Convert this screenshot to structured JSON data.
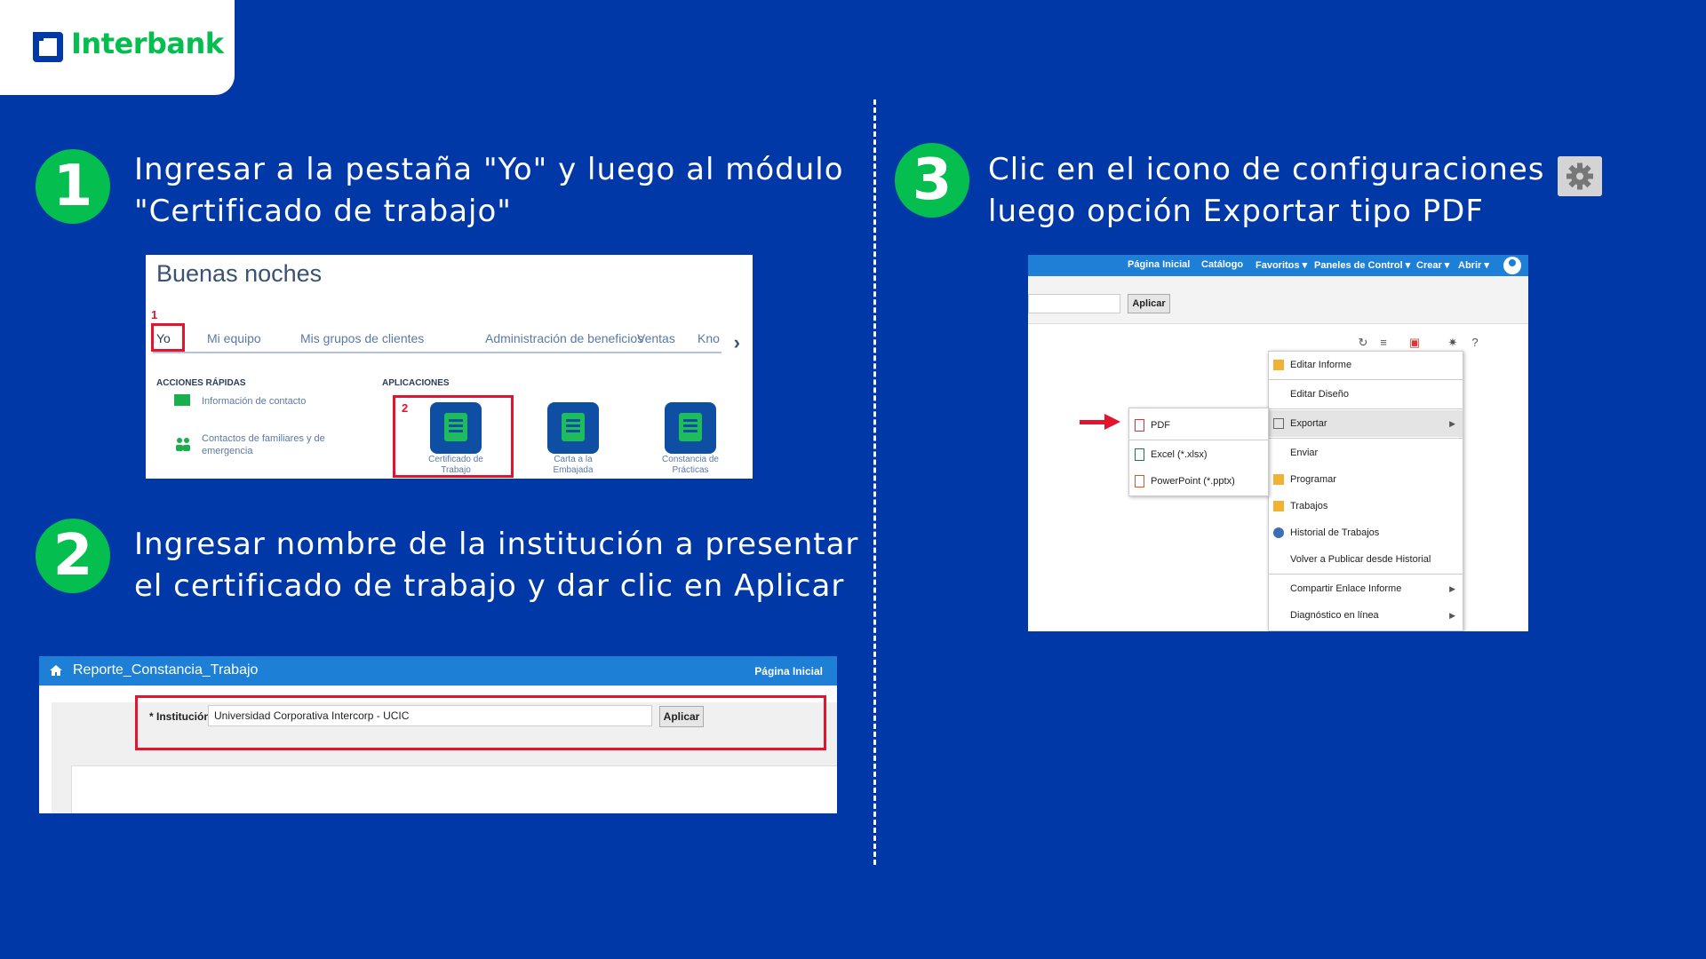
{
  "brand": {
    "name": "Interbank",
    "accent": "#05BE50",
    "background": "#0038A8",
    "alert": "#E3142D"
  },
  "steps": [
    {
      "number": "1",
      "line1": "Ingresar a la pestaña \"Yo\" y luego al módulo",
      "line2": "\"Certificado de trabajo\""
    },
    {
      "number": "2",
      "line1": "Ingresar nombre de la institución a presentar",
      "line2": "el certificado de trabajo y dar clic en Aplicar"
    },
    {
      "number": "3",
      "line1": "Clic en el icono de configuraciones",
      "line2": "luego opción Exportar tipo PDF"
    }
  ],
  "shot1": {
    "greeting": "Buenas noches",
    "tabs": [
      "Yo",
      "Mi equipo",
      "Mis grupos de clientes",
      "Administración de beneficios",
      "Ventas",
      "Kno"
    ],
    "marker1": "1",
    "marker2": "2",
    "quick_actions_title": "ACCIONES RÁPIDAS",
    "quick_actions": [
      "Información de contacto",
      "Contactos de familiares y de",
      "emergencia"
    ],
    "apps_title": "APLICACIONES",
    "apps": [
      {
        "line1": "Certificado de",
        "line2": "Trabajo"
      },
      {
        "line1": "Carta a la",
        "line2": "Embajada"
      },
      {
        "line1": "Constancia de",
        "line2": "Prácticas"
      }
    ]
  },
  "shot2": {
    "title": "Reporte_Constancia_Trabajo",
    "home_link": "Página Inicial",
    "field_label": "* Institución",
    "field_value": "Universidad Corporativa Intercorp - UCIC",
    "apply_label": "Aplicar"
  },
  "shot3": {
    "nav": [
      "Página Inicial",
      "Catálogo",
      "Favoritos ▾",
      "Paneles de Control ▾",
      "Crear ▾",
      "Abrir ▾"
    ],
    "apply_label": "Aplicar",
    "menu": [
      "Editar Informe",
      "Editar Diseño",
      "Exportar",
      "Enviar",
      "Programar",
      "Trabajos",
      "Historial de Trabajos",
      "Volver a Publicar desde Historial",
      "Compartir Enlace Informe",
      "Diagnóstico en línea"
    ],
    "submenu": [
      "PDF",
      "Excel (*.xlsx)",
      "PowerPoint (*.pptx)"
    ]
  }
}
